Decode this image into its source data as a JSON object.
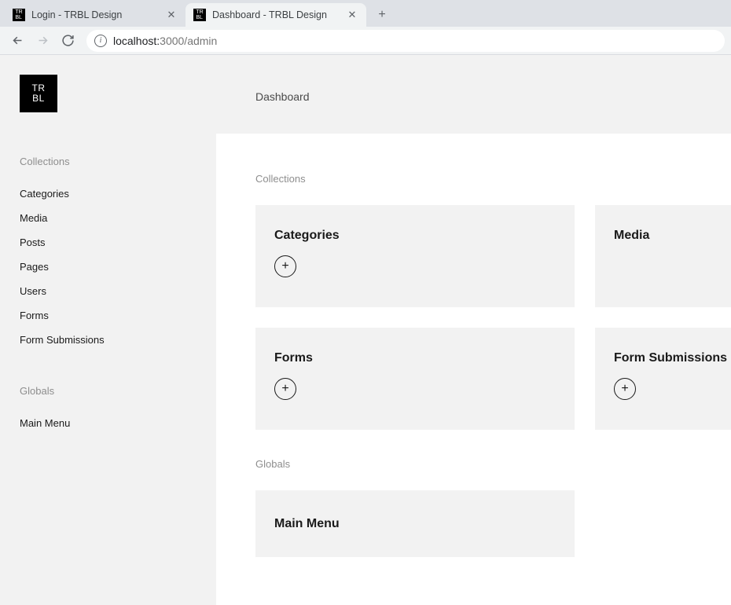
{
  "browser": {
    "tabs": [
      {
        "title": "Login - TRBL Design",
        "active": false
      },
      {
        "title": "Dashboard - TRBL Design",
        "active": true
      }
    ],
    "url_host": "localhost:",
    "url_port_path": "3000/admin"
  },
  "logo_text": "TR\nBL",
  "sidebar": {
    "collections_label": "Collections",
    "collections": [
      "Categories",
      "Media",
      "Posts",
      "Pages",
      "Users",
      "Forms",
      "Form Submissions"
    ],
    "globals_label": "Globals",
    "globals": [
      "Main Menu"
    ]
  },
  "page": {
    "title": "Dashboard",
    "collections_label": "Collections",
    "globals_label": "Globals",
    "collection_cards": [
      {
        "title": "Categories",
        "has_add": true
      },
      {
        "title": "Media",
        "has_add": false
      },
      {
        "title": "Forms",
        "has_add": true
      },
      {
        "title": "Form Submissions",
        "has_add": true
      }
    ],
    "global_cards": [
      {
        "title": "Main Menu"
      }
    ]
  }
}
